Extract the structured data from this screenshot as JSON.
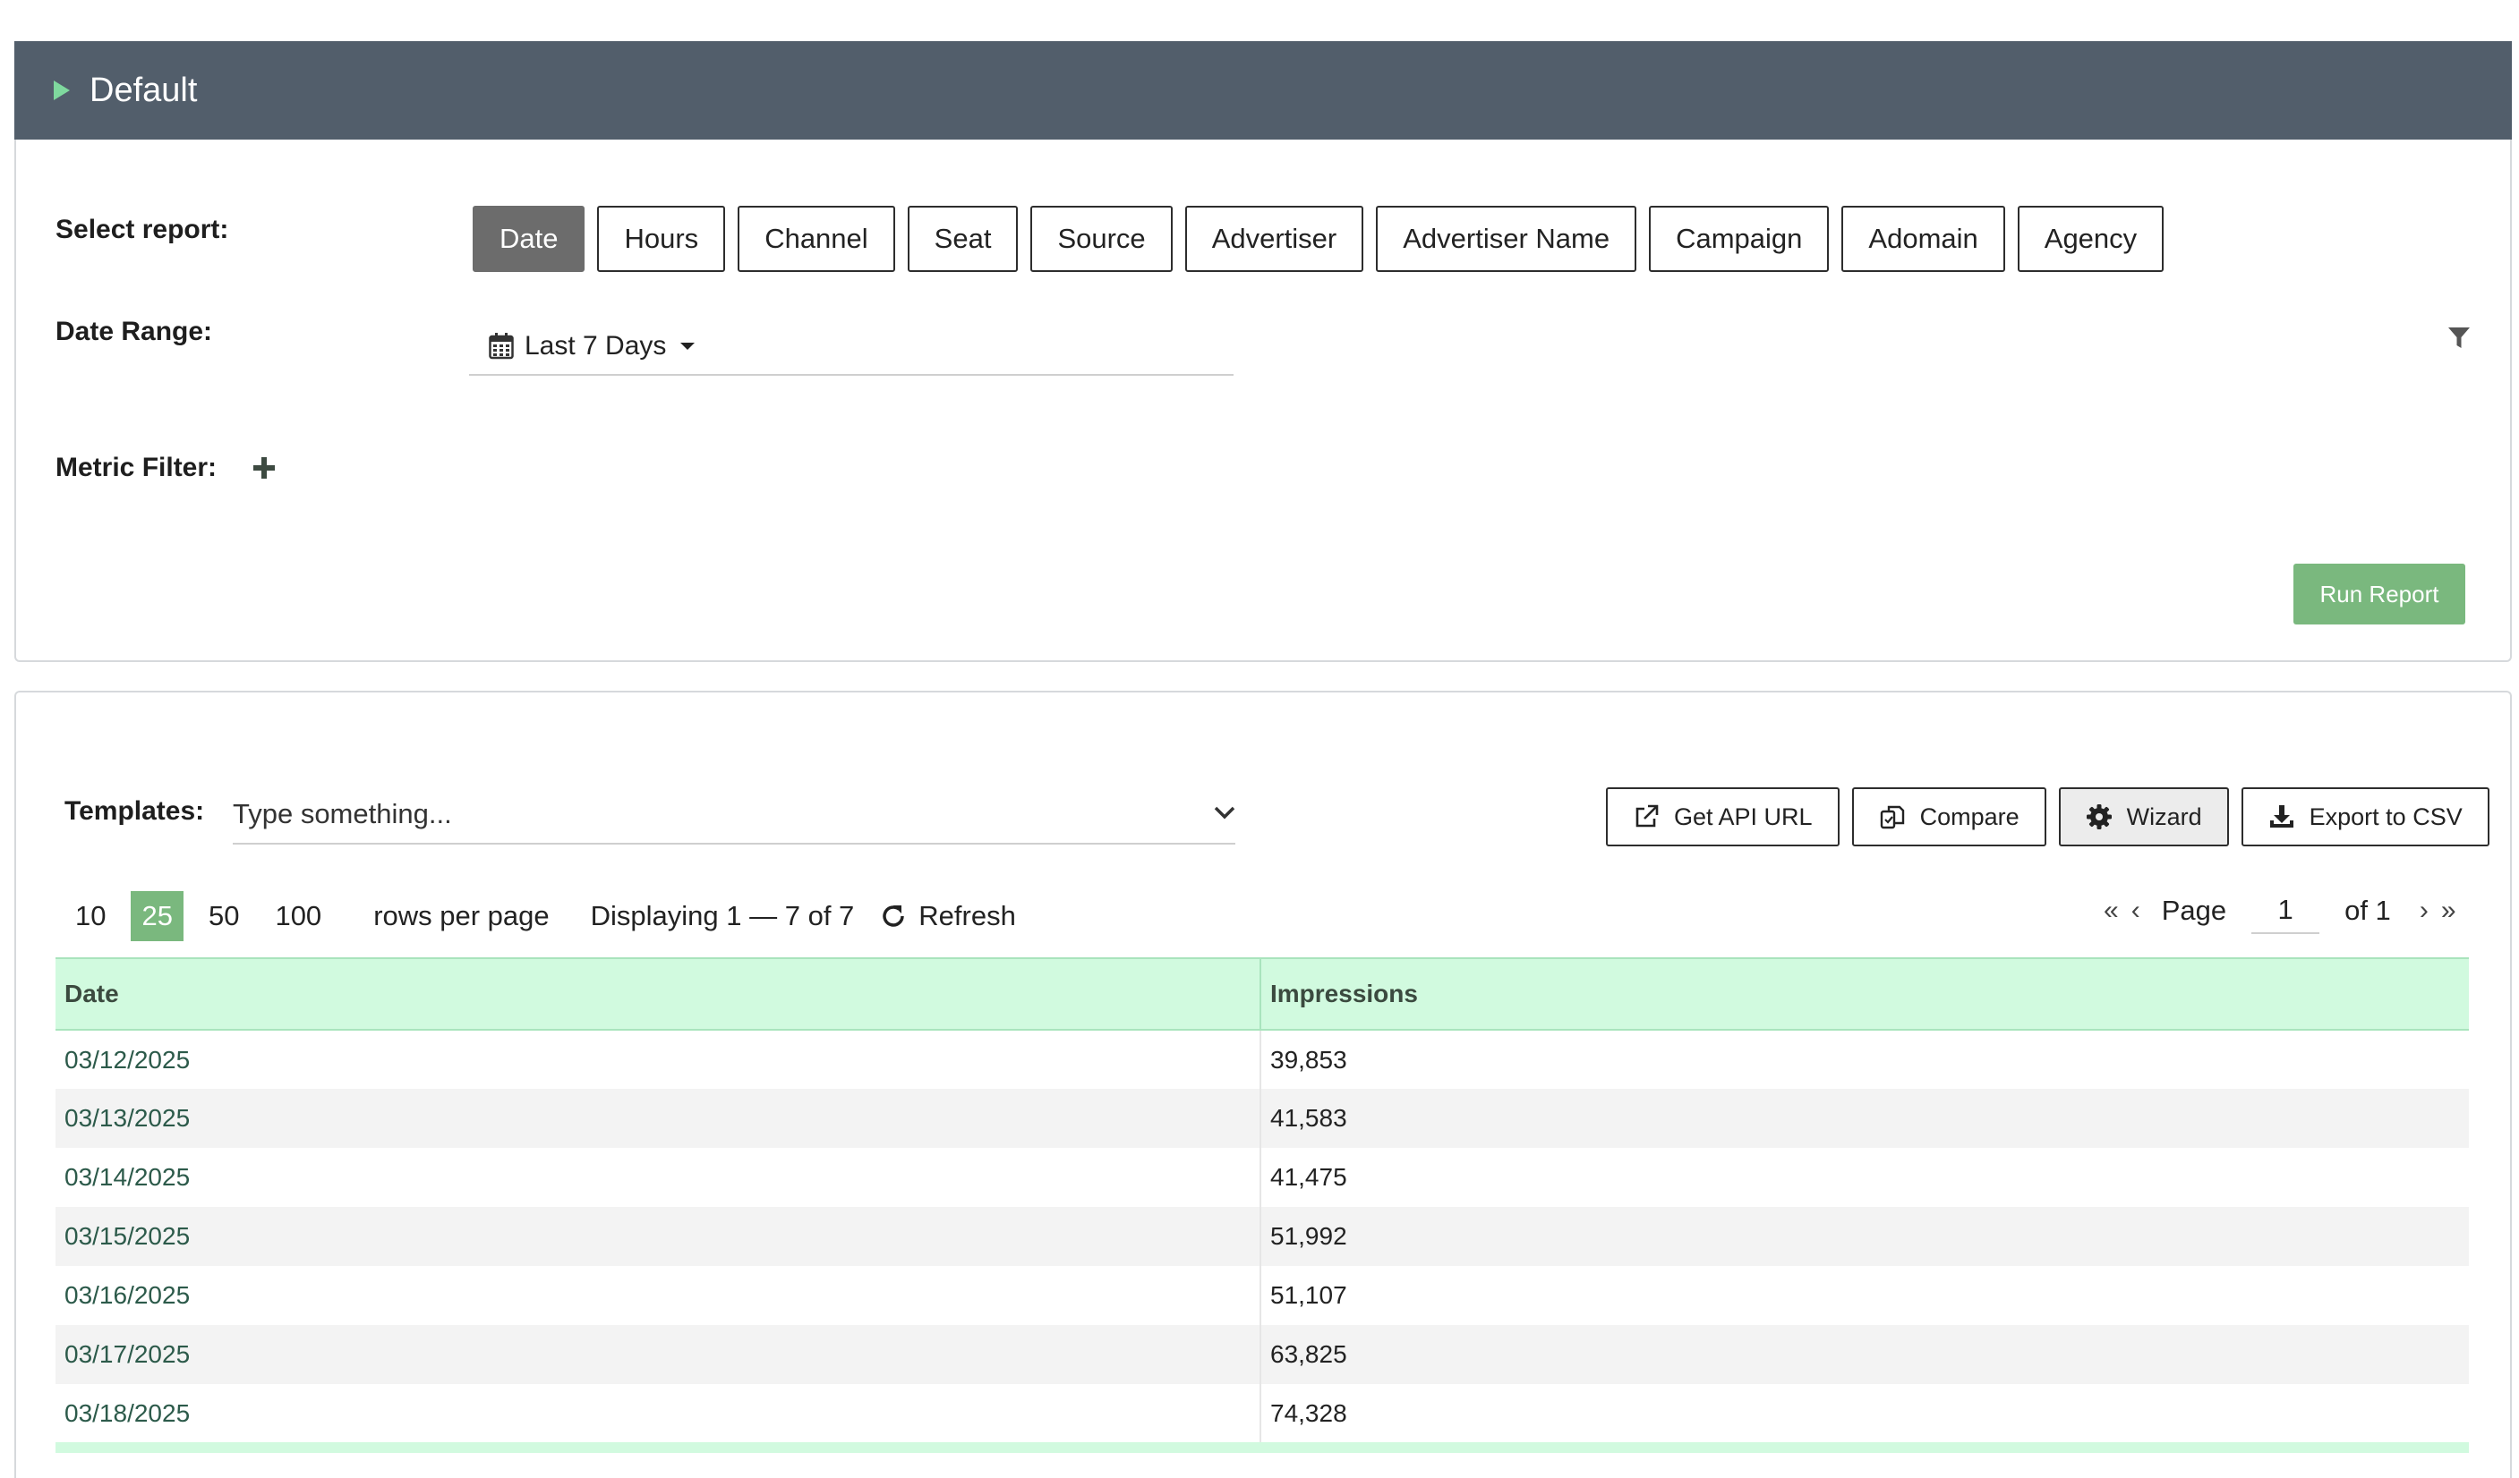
{
  "section": {
    "title": "Default"
  },
  "report": {
    "select_label": "Select report:",
    "buttons": [
      "Date",
      "Hours",
      "Channel",
      "Seat",
      "Source",
      "Advertiser",
      "Advertiser Name",
      "Campaign",
      "Adomain",
      "Agency"
    ],
    "active": "Date"
  },
  "date_range": {
    "label": "Date Range:",
    "value": "Last 7 Days"
  },
  "metric_filter": {
    "label": "Metric Filter:"
  },
  "run_report": "Run Report",
  "templates": {
    "label": "Templates:",
    "placeholder": "Type something..."
  },
  "tools": {
    "api": "Get API URL",
    "compare": "Compare",
    "wizard": "Wizard",
    "export": "Export to CSV"
  },
  "pagination": {
    "sizes": [
      "10",
      "25",
      "50",
      "100"
    ],
    "active_size": "25",
    "rows_per_page": "rows per page",
    "displaying": "Displaying 1 — 7 of 7",
    "refresh": "Refresh",
    "page_label": "Page",
    "page_value": "1",
    "of_label": "of 1"
  },
  "table": {
    "columns": [
      "Date",
      "Impressions"
    ],
    "rows": [
      [
        "03/12/2025",
        "39,853"
      ],
      [
        "03/13/2025",
        "41,583"
      ],
      [
        "03/14/2025",
        "41,475"
      ],
      [
        "03/15/2025",
        "51,992"
      ],
      [
        "03/16/2025",
        "51,107"
      ],
      [
        "03/17/2025",
        "63,825"
      ],
      [
        "03/18/2025",
        "74,328"
      ]
    ]
  },
  "colors": {
    "header_bar": "#525e6b",
    "accent_green": "#7ab87e",
    "table_header": "#d1fadf"
  }
}
